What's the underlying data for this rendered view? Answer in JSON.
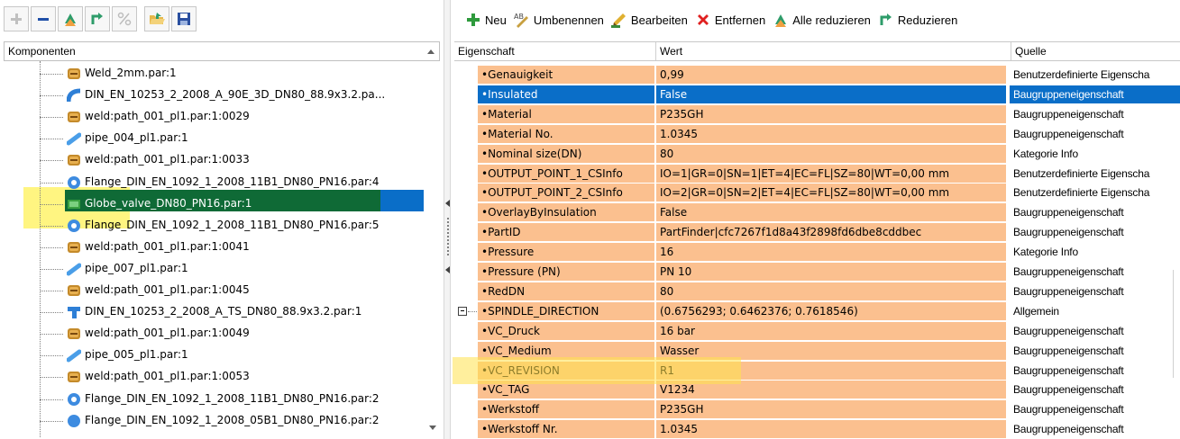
{
  "left_toolbar": {
    "buttons": [
      {
        "icon": "plus-icon",
        "enabled": false
      },
      {
        "icon": "minus-icon",
        "enabled": true
      },
      {
        "icon": "collapse-all-icon",
        "enabled": true
      },
      {
        "icon": "collapse-icon",
        "enabled": true
      },
      {
        "icon": "percent-icon",
        "enabled": false
      },
      {
        "icon": "open-folder-icon",
        "enabled": true
      },
      {
        "icon": "save-icon",
        "enabled": true
      }
    ]
  },
  "tree": {
    "header": "Komponenten",
    "items": [
      {
        "label": "Weld_2mm.par:1",
        "icon": "weld-icon"
      },
      {
        "label": "DIN_EN_10253_2_2008_A_90E_3D_DN80_88.9x3.2.pa...",
        "icon": "elbow-icon"
      },
      {
        "label": "weld:path_001_pl1.par:1:0029",
        "icon": "weld-icon"
      },
      {
        "label": "pipe_004_pl1.par:1",
        "icon": "pipe-icon"
      },
      {
        "label": "weld:path_001_pl1.par:1:0033",
        "icon": "weld-icon"
      },
      {
        "label": "Flange_DIN_EN_1092_1_2008_11B1_DN80_PN16.par:4",
        "icon": "flange-icon"
      },
      {
        "label": "Globe_valve_DN80_PN16.par:1",
        "icon": "valve-icon",
        "selected": true
      },
      {
        "label": "Flange_DIN_EN_1092_1_2008_11B1_DN80_PN16.par:5",
        "icon": "flange-icon"
      },
      {
        "label": "weld:path_001_pl1.par:1:0041",
        "icon": "weld-icon"
      },
      {
        "label": "pipe_007_pl1.par:1",
        "icon": "pipe-icon"
      },
      {
        "label": "weld:path_001_pl1.par:1:0045",
        "icon": "weld-icon"
      },
      {
        "label": "DIN_EN_10253_2_2008_A_TS_DN80_88.9x3.2.par:1",
        "icon": "tee-icon"
      },
      {
        "label": "weld:path_001_pl1.par:1:0049",
        "icon": "weld-icon"
      },
      {
        "label": "pipe_005_pl1.par:1",
        "icon": "pipe-icon"
      },
      {
        "label": "weld:path_001_pl1.par:1:0053",
        "icon": "weld-icon"
      },
      {
        "label": "Flange_DIN_EN_1092_1_2008_11B1_DN80_PN16.par:2",
        "icon": "flange-icon"
      },
      {
        "label": "Flange_DIN_EN_1092_1_2008_05B1_DN80_PN16.par:2",
        "icon": "blind-flange-icon"
      }
    ]
  },
  "right_toolbar": {
    "buttons": [
      {
        "label": "Neu",
        "icon": "add-icon"
      },
      {
        "label": "Umbenennen",
        "icon": "rename-icon"
      },
      {
        "label": "Bearbeiten",
        "icon": "edit-icon"
      },
      {
        "label": "Entfernen",
        "icon": "delete-icon"
      },
      {
        "label": "Alle reduzieren",
        "icon": "collapse-all-icon"
      },
      {
        "label": "Reduzieren",
        "icon": "collapse-icon"
      }
    ]
  },
  "grid": {
    "columns": [
      "Eigenschaft",
      "Wert",
      "Quelle"
    ],
    "rows": [
      {
        "property": "•Genauigkeit",
        "value": "0,99",
        "source": "Benutzerdefinierte Eigenscha"
      },
      {
        "property": "•Insulated",
        "value": "False",
        "source": "Baugruppeneigenschaft",
        "selected": true
      },
      {
        "property": "•Material",
        "value": "P235GH",
        "source": "Baugruppeneigenschaft"
      },
      {
        "property": "•Material No.",
        "value": "1.0345",
        "source": "Baugruppeneigenschaft"
      },
      {
        "property": "•Nominal size(DN)",
        "value": "80",
        "source": "Kategorie Info"
      },
      {
        "property": "•OUTPUT_POINT_1_CSInfo",
        "value": "IO=1|GR=0|SN=1|ET=4|EC=FL|SZ=80|WT=0,00 mm",
        "source": "Benutzerdefinierte Eigenscha"
      },
      {
        "property": "•OUTPUT_POINT_2_CSInfo",
        "value": "IO=2|GR=0|SN=2|ET=4|EC=FL|SZ=80|WT=0,00 mm",
        "source": "Benutzerdefinierte Eigenscha"
      },
      {
        "property": "•OverlayByInsulation",
        "value": "False",
        "source": "Baugruppeneigenschaft"
      },
      {
        "property": "•PartID",
        "value": "PartFinder|cfc7267f1d8a43f2898fd6dbe8cddbec",
        "source": "Baugruppeneigenschaft"
      },
      {
        "property": "•Pressure",
        "value": "16",
        "source": "Kategorie Info"
      },
      {
        "property": "•Pressure (PN)",
        "value": "PN 10",
        "source": "Baugruppeneigenschaft"
      },
      {
        "property": "•RedDN",
        "value": "80",
        "source": "Baugruppeneigenschaft"
      },
      {
        "property": "•SPINDLE_DIRECTION",
        "value": "(0.6756293; 0.6462376; 0.7618546)",
        "source": "Allgemein",
        "expandable": true
      },
      {
        "property": "•VC_Druck",
        "value": "16 bar",
        "source": "Baugruppeneigenschaft"
      },
      {
        "property": "•VC_Medium",
        "value": "Wasser",
        "source": "Baugruppeneigenschaft"
      },
      {
        "property": "•VC_REVISION",
        "value": "R1",
        "source": "Baugruppeneigenschaft"
      },
      {
        "property": "•VC_TAG",
        "value": "V1234",
        "source": "Baugruppeneigenschaft"
      },
      {
        "property": "•Werkstoff",
        "value": "P235GH",
        "source": "Baugruppeneigenschaft"
      },
      {
        "property": "•Werkstoff Nr.",
        "value": "1.0345",
        "source": "Baugruppeneigenschaft"
      }
    ]
  },
  "colors": {
    "row_fill": "#fbc08f",
    "selection_blue": "#0a6ec8",
    "tree_selection_green": "#0f6a36",
    "highlight_yellow": "#fff36b"
  }
}
